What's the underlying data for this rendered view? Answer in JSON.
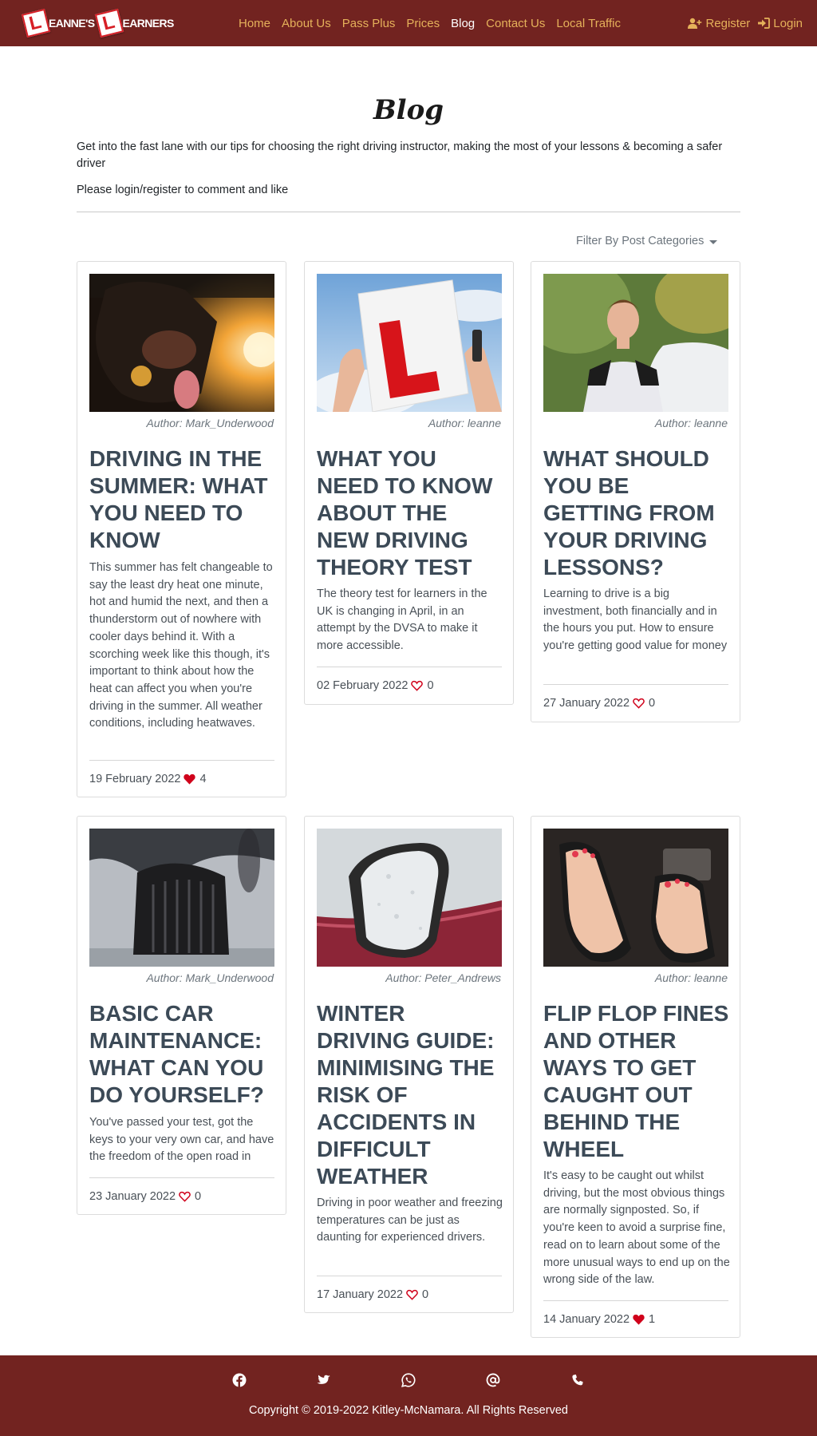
{
  "brand": {
    "word1": "EANNE'S",
    "word2": "EARNERS",
    "plate_letter": "L"
  },
  "nav": {
    "links": [
      "Home",
      "About Us",
      "Pass Plus",
      "Prices",
      "Blog",
      "Contact Us",
      "Local Traffic"
    ],
    "active": "Blog",
    "register": "Register",
    "login": "Login"
  },
  "header": {
    "title": "Blog",
    "intro": "Get into the fast lane with our tips for choosing the right driving instructor, making the most of your lessons & becoming a safer driver",
    "notice": "Please login/register to comment and like",
    "filter_label": "Filter By Post Categories"
  },
  "posts": [
    {
      "author": "Author: Mark_Underwood",
      "title": "DRIVING IN THE SUMMER: WHAT YOU NEED TO KNOW",
      "excerpt": "This summer has felt changeable to say the least dry heat one minute, hot and humid the next, and then a thunderstorm out of nowhere with cooler days behind it. With a scorching week like this though, it's important to think about how the heat can affect you when you're driving in the summer. All weather conditions, including heatwaves.",
      "date": "19 February 2022",
      "likes": "4",
      "liked": true,
      "image_icon": "dog-in-car-photo"
    },
    {
      "author": "Author: leanne",
      "title": "WHAT YOU NEED TO KNOW ABOUT THE NEW DRIVING THEORY TEST",
      "excerpt": "The theory test for learners in the UK is changing in April, in an attempt by the DVSA to make it more accessible.",
      "date": "02 February 2022",
      "likes": "0",
      "liked": false,
      "image_icon": "l-plate-photo"
    },
    {
      "author": "Author: leanne",
      "title": "WHAT SHOULD YOU BE GETTING FROM YOUR DRIVING LESSONS?",
      "excerpt": "Learning to drive is a big investment, both financially and in the hours you put. How to ensure you're getting good value for money",
      "date": "27 January 2022",
      "likes": "0",
      "liked": false,
      "image_icon": "teen-by-car-photo"
    },
    {
      "author": "Author: Mark_Underwood",
      "title": "BASIC CAR MAINTENANCE: WHAT CAN YOU DO YOURSELF?",
      "excerpt": "You've passed your test, got the keys to your very own car, and have the freedom of the open road in",
      "date": "23 January 2022",
      "likes": "0",
      "liked": false,
      "image_icon": "car-tyre-photo"
    },
    {
      "author": "Author: Peter_Andrews",
      "title": "WINTER DRIVING GUIDE: MINIMISING THE RISK OF ACCIDENTS IN DIFFICULT WEATHER",
      "excerpt": "Driving in poor weather and freezing temperatures can be just as daunting for experienced drivers.",
      "date": "17 January 2022",
      "likes": "0",
      "liked": false,
      "image_icon": "frosty-mirror-photo"
    },
    {
      "author": "Author: leanne",
      "title": "FLIP FLOP FINES AND OTHER WAYS TO GET CAUGHT OUT BEHIND THE WHEEL",
      "excerpt": "It's easy to be caught out whilst driving, but the most obvious things are normally signposted. So, if you're keen to avoid a surprise fine, read on to learn about some of the more unusual ways to end up on the wrong side of the law.",
      "date": "14 January 2022",
      "likes": "1",
      "liked": true,
      "image_icon": "flip-flops-pedals-photo"
    }
  ],
  "footer": {
    "icons": [
      "facebook-icon",
      "twitter-icon",
      "whatsapp-icon",
      "email-icon",
      "phone-icon"
    ],
    "copyright": "Copyright © 2019-2022 Kitley-McNamara. All Rights Reserved"
  },
  "colors": {
    "brand_maroon": "#722320",
    "nav_gold": "#e5b15a",
    "heart_red": "#d0021b",
    "title_slate": "#3c4a57"
  }
}
